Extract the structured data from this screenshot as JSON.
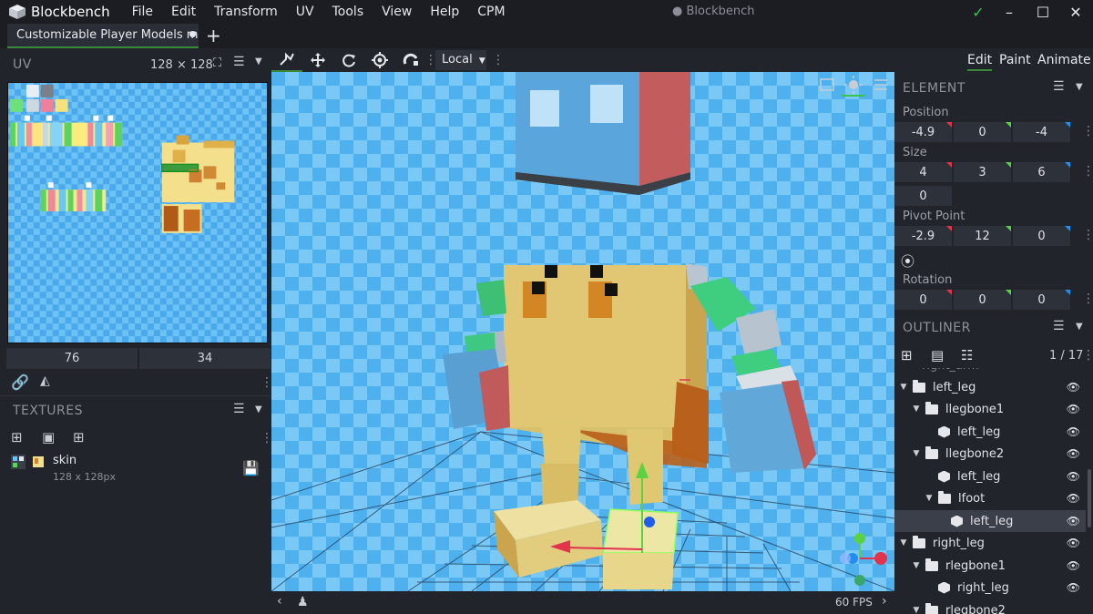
{
  "app": {
    "name": "Blockbench",
    "window_title": "● Blockbench"
  },
  "menu": [
    "File",
    "Edit",
    "Transform",
    "UV",
    "Tools",
    "View",
    "Help",
    "CPM"
  ],
  "tabs": [
    {
      "label": "Customizable Player Models m"
    }
  ],
  "uv_panel": {
    "title": "UV",
    "size": "128 × 128",
    "x": "76",
    "y": "34"
  },
  "textures_panel": {
    "title": "TEXTURES",
    "items": [
      {
        "name": "skin",
        "size": "128 x 128px"
      }
    ]
  },
  "toolbar": {
    "space": "Local"
  },
  "modes": [
    "Edit",
    "Paint",
    "Animate"
  ],
  "element_panel": {
    "title": "ELEMENT",
    "position_label": "Position",
    "position": [
      "-4.9",
      "0",
      "-4"
    ],
    "size_label": "Size",
    "size": [
      "4",
      "3",
      "6"
    ],
    "inflate": "0",
    "pivot_label": "Pivot Point",
    "pivot": [
      "-2.9",
      "12",
      "0"
    ],
    "rotation_label": "Rotation",
    "rotation": [
      "0",
      "0",
      "0"
    ]
  },
  "outliner": {
    "title": "OUTLINER",
    "count": "1 / 17",
    "items": [
      {
        "label": "left_leg",
        "type": "folder",
        "depth": 0
      },
      {
        "label": "llegbone1",
        "type": "folder",
        "depth": 1
      },
      {
        "label": "left_leg",
        "type": "cube",
        "depth": 2
      },
      {
        "label": "llegbone2",
        "type": "folder",
        "depth": 1
      },
      {
        "label": "left_leg",
        "type": "cube",
        "depth": 2
      },
      {
        "label": "lfoot",
        "type": "folder",
        "depth": 2
      },
      {
        "label": "left_leg",
        "type": "cube",
        "depth": 3,
        "selected": true
      },
      {
        "label": "right_leg",
        "type": "folder",
        "depth": 0
      },
      {
        "label": "rlegbone1",
        "type": "folder",
        "depth": 1
      },
      {
        "label": "right_leg",
        "type": "cube",
        "depth": 2
      },
      {
        "label": "rlegbone2",
        "type": "folder",
        "depth": 1
      }
    ]
  },
  "status": {
    "fps": "60 FPS"
  },
  "colors": {
    "accent": "#3b8a3c",
    "x_axis": "#e2334d",
    "y_axis": "#5ad241",
    "z_axis": "#1f8ff0"
  }
}
